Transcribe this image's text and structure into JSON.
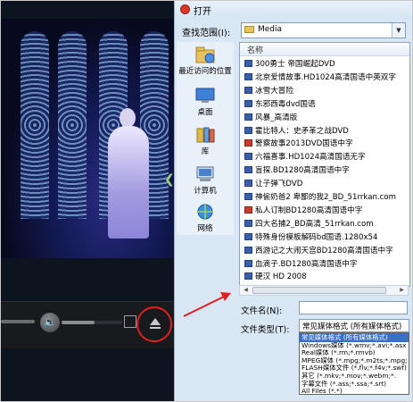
{
  "dialog": {
    "title": "打开",
    "look_in_label": "查找范围(I):",
    "look_in_value": "Media",
    "column_name": "名称",
    "places": [
      {
        "label": "最近访问的位置",
        "icon": "recent-places-icon"
      },
      {
        "label": "桌面",
        "icon": "desktop-icon"
      },
      {
        "label": "库",
        "icon": "libraries-icon"
      },
      {
        "label": "计算机",
        "icon": "computer-icon"
      },
      {
        "label": "网络",
        "icon": "network-icon"
      }
    ],
    "files": [
      {
        "name": "300勇士 帝国崛起DVD",
        "color": "blue"
      },
      {
        "name": "北京爱情故事.HD1024高清国语中英双字",
        "color": "blue"
      },
      {
        "name": "冰雪大冒险",
        "color": "blue"
      },
      {
        "name": "东邪西毒dvd国语",
        "color": "blue"
      },
      {
        "name": "风暴_高清版",
        "color": "blue"
      },
      {
        "name": "霍比特人：史矛革之战DVD",
        "color": "blue"
      },
      {
        "name": "警察故事2013DVD国语中字",
        "color": "red"
      },
      {
        "name": "六福喜事.HD1024高清国语无字",
        "color": "blue"
      },
      {
        "name": "盲探.BD1280高清国语中字",
        "color": "blue"
      },
      {
        "name": "让子弹飞DVD",
        "color": "blue"
      },
      {
        "name": "神偷奶爸2 卑鄙的我2_BD_51rrkan.com",
        "color": "blue"
      },
      {
        "name": "私人订制BD1280高清国语中字",
        "color": "red"
      },
      {
        "name": "四大名捕2_BD高清_51rrkan.com",
        "color": "blue"
      },
      {
        "name": "特殊身份模板解码bd国语.1280x54",
        "color": "blue"
      },
      {
        "name": "西游记之大闹天宫BD1280高清国语中字",
        "color": "blue"
      },
      {
        "name": "血滴子.BD1280高清国语中字",
        "color": "blue"
      },
      {
        "name": "硬汉 HD 2008",
        "color": "blue"
      }
    ],
    "filename_label": "文件名(N):",
    "filename_value": "",
    "filetype_label": "文件类型(T):",
    "filetype_selected": "常见媒体格式 (所有媒体格式)",
    "filetype_options": [
      "常见媒体格式 (所有媒体格式)",
      "Windows媒体 (*.wmv;*.avi;*.asx",
      "Real媒体 (*.rm;*.rmvb)",
      "MPEG媒体 (*.mpg;*.m2ts;*.mpg;",
      "FLASH媒体文件 (*.flv;*.f4v;*.swf)",
      "其它 (*.mkv;*.mov;*.webm;*.",
      "字幕文件 (*.ass;*.ssa;*.srt)",
      "All Files (*.*)"
    ]
  },
  "player": {
    "volume_level": 0.55,
    "icons": [
      "volume-icon",
      "fullscreen-icon",
      "eject-icon"
    ]
  },
  "colors": {
    "annotation": "#e02020",
    "dialog_bg": "#d9e6f4",
    "selection": "#3a6fc8"
  }
}
